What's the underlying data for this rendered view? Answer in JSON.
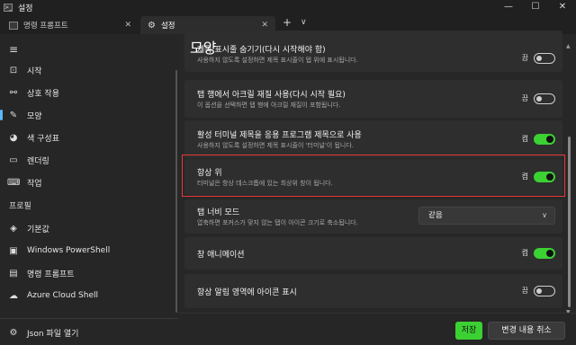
{
  "window": {
    "title": "설정",
    "app_icon": ">_",
    "minimize": "—",
    "maximize": "☐",
    "close": "✕"
  },
  "tabs": [
    {
      "label": "명령 프롬프트",
      "close": "✕",
      "icon": "terminal-icon"
    },
    {
      "label": "설정",
      "close": "✕",
      "icon": "gear-icon"
    }
  ],
  "tabbar": {
    "new_tab": "+",
    "dropdown": "∨"
  },
  "sidebar": {
    "menu_icon": "≡",
    "items": [
      {
        "label": "시작",
        "icon": "⊡"
      },
      {
        "label": "상호 작용",
        "icon": "⚯"
      },
      {
        "label": "모양",
        "icon": "✎"
      },
      {
        "label": "색 구성표",
        "icon": "◕"
      },
      {
        "label": "렌더링",
        "icon": "▭"
      },
      {
        "label": "작업",
        "icon": "⌨"
      }
    ],
    "profiles_label": "프로필",
    "profiles": [
      {
        "label": "기본값",
        "icon": "◈"
      },
      {
        "label": "Windows PowerShell",
        "icon": "▣"
      },
      {
        "label": "명령 프롬프트",
        "icon": "▤"
      },
      {
        "label": "Azure Cloud Shell",
        "icon": "☁"
      }
    ],
    "open_json": {
      "label": "Json 파일 열기",
      "icon": "⚙"
    }
  },
  "main": {
    "title": "모양",
    "settings": [
      {
        "title": "제목 표시줄 숨기기(다시 시작해야 함)",
        "desc": "사용하지 않도록 설정하면 제목 표시줄이 탭 위에 표시됩니다.",
        "state": "끔",
        "on": false
      },
      {
        "title": "탭 행에서 아크릴 재질 사용(다시 시작 필요)",
        "desc": "이 옵션을 선택하면 탭 행에 아크릴 재질이 포함됩니다.",
        "state": "끔",
        "on": false
      },
      {
        "title": "활성 터미널 제목을 응용 프로그램 제목으로 사용",
        "desc": "사용하지 않도록 설정하면 제목 표시줄이 '터미널'이 됩니다.",
        "state": "켬",
        "on": true
      },
      {
        "title": "항상 위",
        "desc": "터미널은 항상 데스크톱에 있는 최상위 창이 됩니다.",
        "state": "켬",
        "on": true
      },
      {
        "title": "탭 너비 모드",
        "desc": "압축하면 포커스가 맞지 않는 탭이 아이콘 크기로 축소됩니다.",
        "select_value": "같음"
      },
      {
        "title": "창 애니메이션",
        "state": "켬",
        "on": true
      },
      {
        "title": "항상 알림 영역에 아이콘 표시",
        "state": "끔",
        "on": false
      }
    ]
  },
  "footer": {
    "save": "저장",
    "discard": "변경 내용 취소"
  }
}
